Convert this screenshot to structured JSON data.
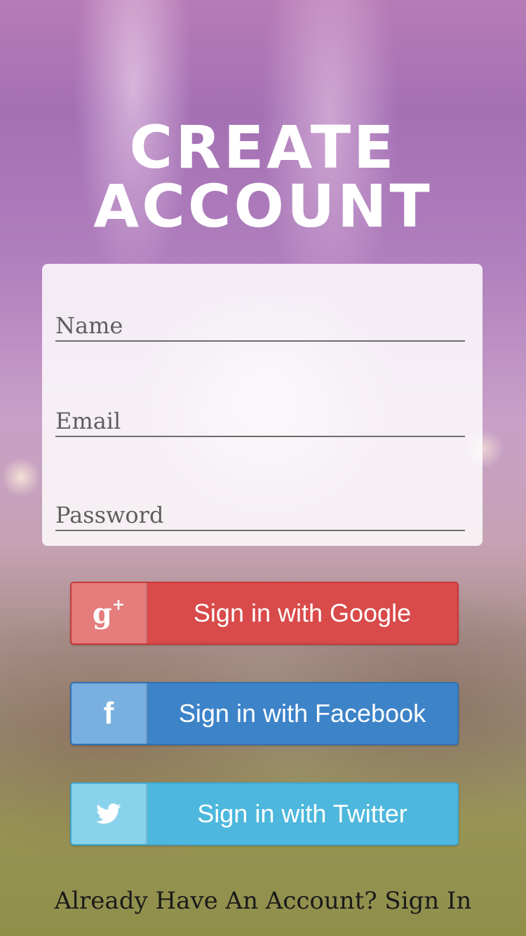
{
  "header": {
    "title": "Create Account"
  },
  "form": {
    "name_placeholder": "Name",
    "email_placeholder": "Email",
    "password_placeholder": "Password"
  },
  "social": {
    "google": {
      "label": "Sign in with Google",
      "icon": "google-plus-icon",
      "color": "#d94a4a"
    },
    "facebook": {
      "label": "Sign in with Facebook",
      "icon": "facebook-icon",
      "color": "#3d83c8"
    },
    "twitter": {
      "label": "Sign in with Twitter",
      "icon": "twitter-icon",
      "color": "#4db7dd"
    }
  },
  "footer": {
    "prompt": "Already Have An Account?",
    "link": "Sign In"
  }
}
